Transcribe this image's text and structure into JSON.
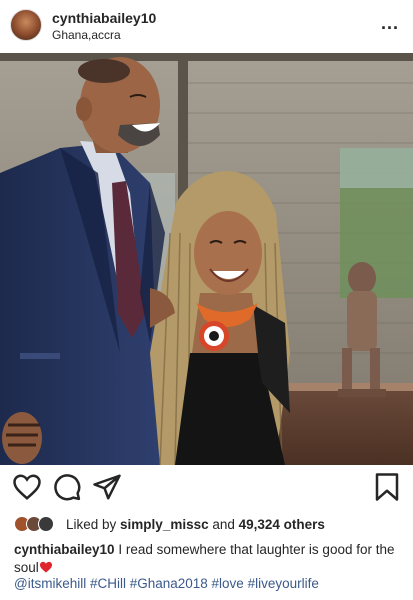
{
  "post": {
    "username": "cynthiabailey10",
    "location": "Ghana,accra",
    "more_label": "..."
  },
  "likes": {
    "prefix": "Liked by ",
    "liked_by": "simply_missc",
    "middle": " and ",
    "count": "49,324 others"
  },
  "caption": {
    "username": "cynthiabailey10",
    "text": "I read somewhere that laughter is good for the soul"
  },
  "tags": "@itsmikehill #CHill #Ghana2018 #love #liveyourlife",
  "icons": [
    "heart-icon",
    "comment-icon",
    "share-icon",
    "bookmark-icon"
  ],
  "colors": {
    "link": "#3b5a8a",
    "text": "#262626",
    "heart": "#e0242c"
  }
}
